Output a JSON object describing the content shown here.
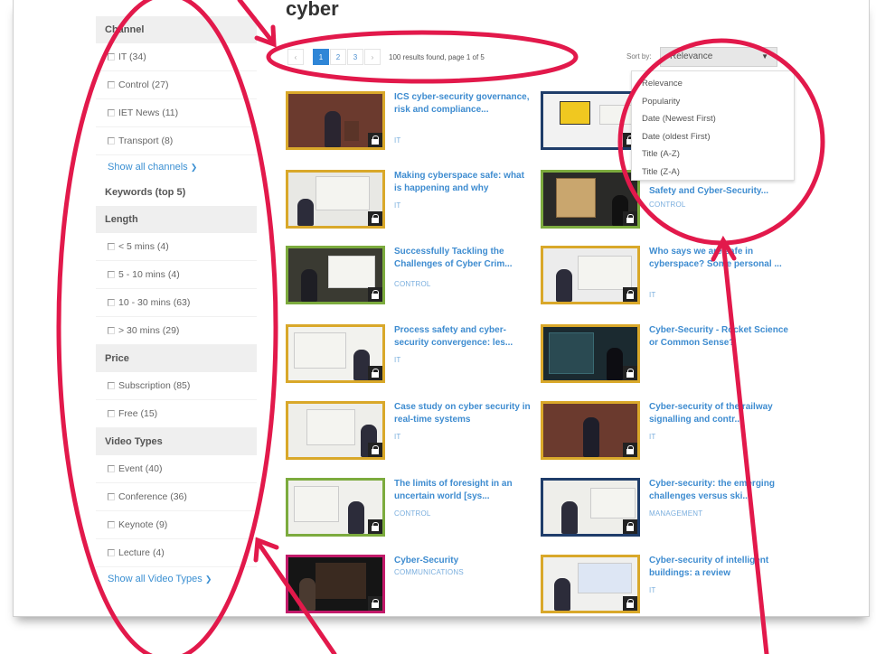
{
  "page": {
    "title": "cyber"
  },
  "sidebar": {
    "channel_header": "Channel",
    "channels": [
      "IT (34)",
      "Control (27)",
      "IET News (11)",
      "Transport (8)"
    ],
    "show_all_channels": "Show all channels",
    "keywords_header": "Keywords (top 5)",
    "length_header": "Length",
    "lengths": [
      "< 5 mins (4)",
      "5 - 10 mins (4)",
      "10 - 30 mins (63)",
      "> 30 mins (29)"
    ],
    "price_header": "Price",
    "prices": [
      "Subscription (85)",
      "Free (15)"
    ],
    "video_types_header": "Video Types",
    "video_types": [
      "Event (40)",
      "Conference (36)",
      "Keynote (9)",
      "Lecture (4)"
    ],
    "show_all_video_types": "Show all Video Types"
  },
  "pagination": {
    "prev": "‹",
    "pages": [
      "1",
      "2",
      "3"
    ],
    "next": "›",
    "results_text": "100 results found, page 1 of 5"
  },
  "sort": {
    "label": "Sort by:",
    "selected": "Relevance",
    "options": [
      "Relevance",
      "Popularity",
      "Date (Newest First)",
      "Date (oldest First)",
      "Title (A-Z)",
      "Title (Z-A)"
    ]
  },
  "videos": [
    {
      "title": "ICS cyber-security governance, risk and compliance...",
      "category": "IT"
    },
    {
      "title": "Making cyberspace safe: what is happening and why",
      "category": "IT"
    },
    {
      "title": "Successfully Tackling the Challenges of Cyber Crim...",
      "category": "CONTROL"
    },
    {
      "title": "Process safety and cyber-security convergence: les...",
      "category": "IT"
    },
    {
      "title": "Case study on cyber security in real-time systems",
      "category": "IT"
    },
    {
      "title": "The limits of foresight in an uncertain world [sys...",
      "category": "CONTROL"
    },
    {
      "title": "Cyber-Security",
      "category": "COMMUNICATIONS"
    },
    {
      "title": "Safety and Cyber-Security...",
      "category": "CONTROL"
    },
    {
      "title": "Who says we are safe in cyberspace? Some personal ...",
      "category": "IT"
    },
    {
      "title": "Cyber-Security - Rocket Science or Common Sense?",
      "category": ""
    },
    {
      "title": "Cyber-security of the railway signalling and contr...",
      "category": "IT"
    },
    {
      "title": "Cyber-security: the emerging challenges versus ski...",
      "category": "MANAGEMENT"
    },
    {
      "title": "Cyber-security of intelligent buildings: a review",
      "category": "IT"
    }
  ],
  "colors": {
    "link": "#3e8cd0",
    "annotation": "#e2194b",
    "pager_active": "#2f86d7"
  }
}
